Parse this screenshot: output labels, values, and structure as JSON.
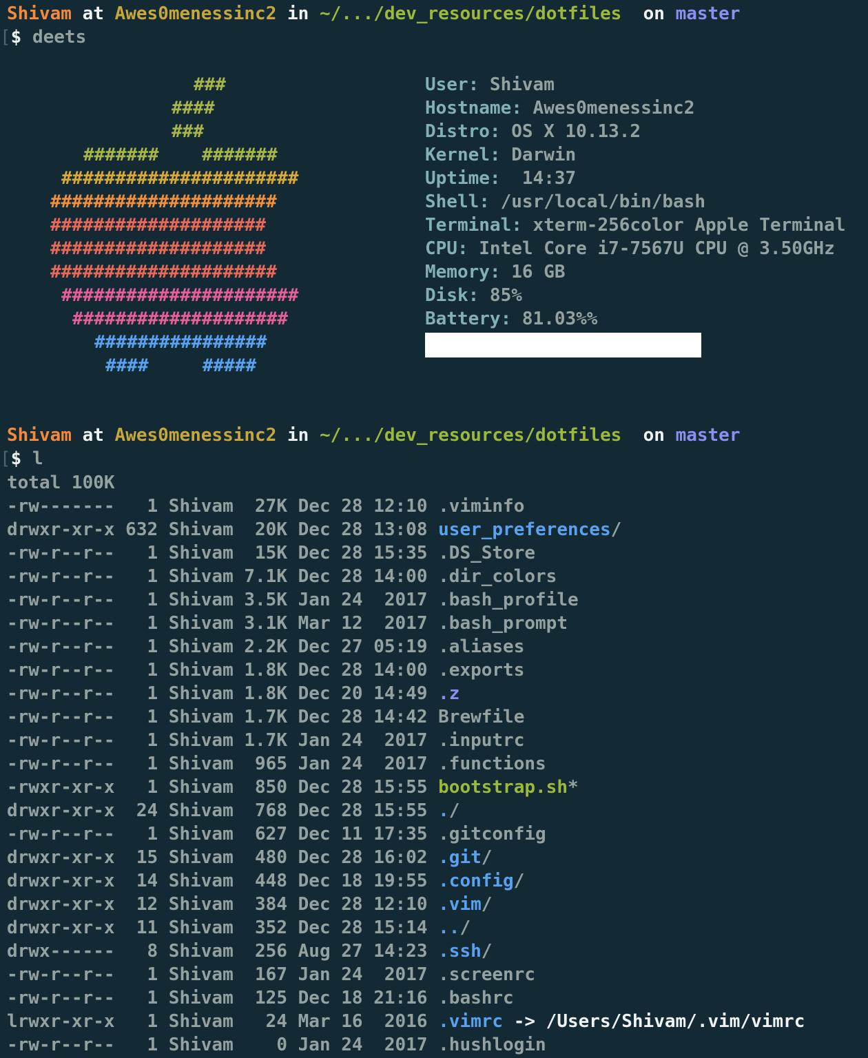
{
  "prompt1": {
    "user": "Shivam",
    "at": "at",
    "host": "Awes0menessinc2",
    "in": "in",
    "path": "~/.../dev_resources/dotfiles",
    "on": "on",
    "branch": "master",
    "bracket": "[",
    "dollar": "$",
    "command": "deets"
  },
  "logo": {
    "rows": [
      {
        "text": "###",
        "color": "#a8b54a"
      },
      {
        "text": "####",
        "color": "#a8b54a"
      },
      {
        "text": "###",
        "color": "#a8b54a"
      },
      {
        "text": "#######    #######",
        "color": "#a8b54a"
      },
      {
        "text": "######################",
        "color": "#d9a93a"
      },
      {
        "text": "#####################",
        "color": "#f08f3c"
      },
      {
        "text": "####################",
        "color": "#e8685a"
      },
      {
        "text": "####################",
        "color": "#e8685a"
      },
      {
        "text": "#####################",
        "color": "#e8685a"
      },
      {
        "text": "######################",
        "color": "#e65f99"
      },
      {
        "text": "####################",
        "color": "#e65f99"
      },
      {
        "text": "################",
        "color": "#5aa1f0"
      },
      {
        "text": "####     #####",
        "color": "#5aa1f0"
      }
    ]
  },
  "info": [
    {
      "key": "User:",
      "value": " Shivam"
    },
    {
      "key": "Hostname:",
      "value": " Awes0menessinc2"
    },
    {
      "key": "Distro:",
      "value": " OS X 10.13.2"
    },
    {
      "key": "Kernel:",
      "value": " Darwin"
    },
    {
      "key": "Uptime:",
      "value": "  14:37"
    },
    {
      "key": "Shell:",
      "value": " /usr/local/bin/bash"
    },
    {
      "key": "Terminal:",
      "value": " xterm-256color Apple Terminal"
    },
    {
      "key": "CPU:",
      "value": " Intel Core i7-7567U CPU @ 3.50GHz"
    },
    {
      "key": "Memory:",
      "value": " 16 GB"
    },
    {
      "key": "Disk:",
      "value": " 85%"
    },
    {
      "key": "Battery:",
      "value": " 81.03%%"
    }
  ],
  "prompt2": {
    "user": "Shivam",
    "at": "at",
    "host": "Awes0menessinc2",
    "in": "in",
    "path": "~/.../dev_resources/dotfiles",
    "on": "on",
    "branch": "master",
    "bracket": "[",
    "dollar": "$",
    "command": "l"
  },
  "listing": {
    "total": "total 100K",
    "rows": [
      {
        "meta": "-rw-------   1 Shivam  27K Dec 28 12:10 ",
        "name": ".viminfo",
        "kind": "plain",
        "suffix": ""
      },
      {
        "meta": "drwxr-xr-x 632 Shivam  20K Dec 28 13:08 ",
        "name": "user_preferences",
        "kind": "dir",
        "suffix": "/"
      },
      {
        "meta": "-rw-r--r--   1 Shivam  15K Dec 28 15:35 ",
        "name": ".DS_Store",
        "kind": "plain",
        "suffix": ""
      },
      {
        "meta": "-rw-r--r--   1 Shivam 7.1K Dec 28 14:00 ",
        "name": ".dir_colors",
        "kind": "plain",
        "suffix": ""
      },
      {
        "meta": "-rw-r--r--   1 Shivam 3.5K Jan 24  2017 ",
        "name": ".bash_profile",
        "kind": "plain",
        "suffix": ""
      },
      {
        "meta": "-rw-r--r--   1 Shivam 3.1K Mar 12  2017 ",
        "name": ".bash_prompt",
        "kind": "plain",
        "suffix": ""
      },
      {
        "meta": "-rw-r--r--   1 Shivam 2.2K Dec 27 05:19 ",
        "name": ".aliases",
        "kind": "plain",
        "suffix": ""
      },
      {
        "meta": "-rw-r--r--   1 Shivam 1.8K Dec 28 14:00 ",
        "name": ".exports",
        "kind": "plain",
        "suffix": ""
      },
      {
        "meta": "-rw-r--r--   1 Shivam 1.8K Dec 20 14:49 ",
        "name": ".z",
        "kind": "z",
        "suffix": ""
      },
      {
        "meta": "-rw-r--r--   1 Shivam 1.7K Dec 28 14:42 ",
        "name": "Brewfile",
        "kind": "plain",
        "suffix": ""
      },
      {
        "meta": "-rw-r--r--   1 Shivam 1.7K Jan 24  2017 ",
        "name": ".inputrc",
        "kind": "plain",
        "suffix": ""
      },
      {
        "meta": "-rw-r--r--   1 Shivam  965 Jan 24  2017 ",
        "name": ".functions",
        "kind": "plain",
        "suffix": ""
      },
      {
        "meta": "-rwxr-xr-x   1 Shivam  850 Dec 28 15:55 ",
        "name": "bootstrap.sh",
        "kind": "exec",
        "suffix": "*"
      },
      {
        "meta": "drwxr-xr-x  24 Shivam  768 Dec 28 15:55 ",
        "name": ".",
        "kind": "dir",
        "suffix": "/"
      },
      {
        "meta": "-rw-r--r--   1 Shivam  627 Dec 11 17:35 ",
        "name": ".gitconfig",
        "kind": "plain",
        "suffix": ""
      },
      {
        "meta": "drwxr-xr-x  15 Shivam  480 Dec 28 16:02 ",
        "name": ".git",
        "kind": "dir",
        "suffix": "/"
      },
      {
        "meta": "drwxr-xr-x  14 Shivam  448 Dec 18 19:55 ",
        "name": ".config",
        "kind": "dir",
        "suffix": "/"
      },
      {
        "meta": "drwxr-xr-x  12 Shivam  384 Dec 28 12:10 ",
        "name": ".vim",
        "kind": "dir",
        "suffix": "/"
      },
      {
        "meta": "drwxr-xr-x  11 Shivam  352 Dec 28 15:14 ",
        "name": "..",
        "kind": "dir",
        "suffix": "/"
      },
      {
        "meta": "drwx------   8 Shivam  256 Aug 27 14:23 ",
        "name": ".ssh",
        "kind": "dir",
        "suffix": "/"
      },
      {
        "meta": "-rw-r--r--   1 Shivam  167 Jan 24  2017 ",
        "name": ".screenrc",
        "kind": "plain",
        "suffix": ""
      },
      {
        "meta": "-rw-r--r--   1 Shivam  125 Dec 18 21:16 ",
        "name": ".bashrc",
        "kind": "plain",
        "suffix": ""
      },
      {
        "meta": "lrwxr-xr-x   1 Shivam   24 Mar 16  2016 ",
        "name": ".vimrc",
        "kind": "link",
        "suffix": " -> /Users/Shivam/.vim/vimrc"
      },
      {
        "meta": "-rw-r--r--   1 Shivam    0 Jan 24  2017 ",
        "name": ".hushlogin",
        "kind": "plain",
        "suffix": ""
      }
    ]
  }
}
